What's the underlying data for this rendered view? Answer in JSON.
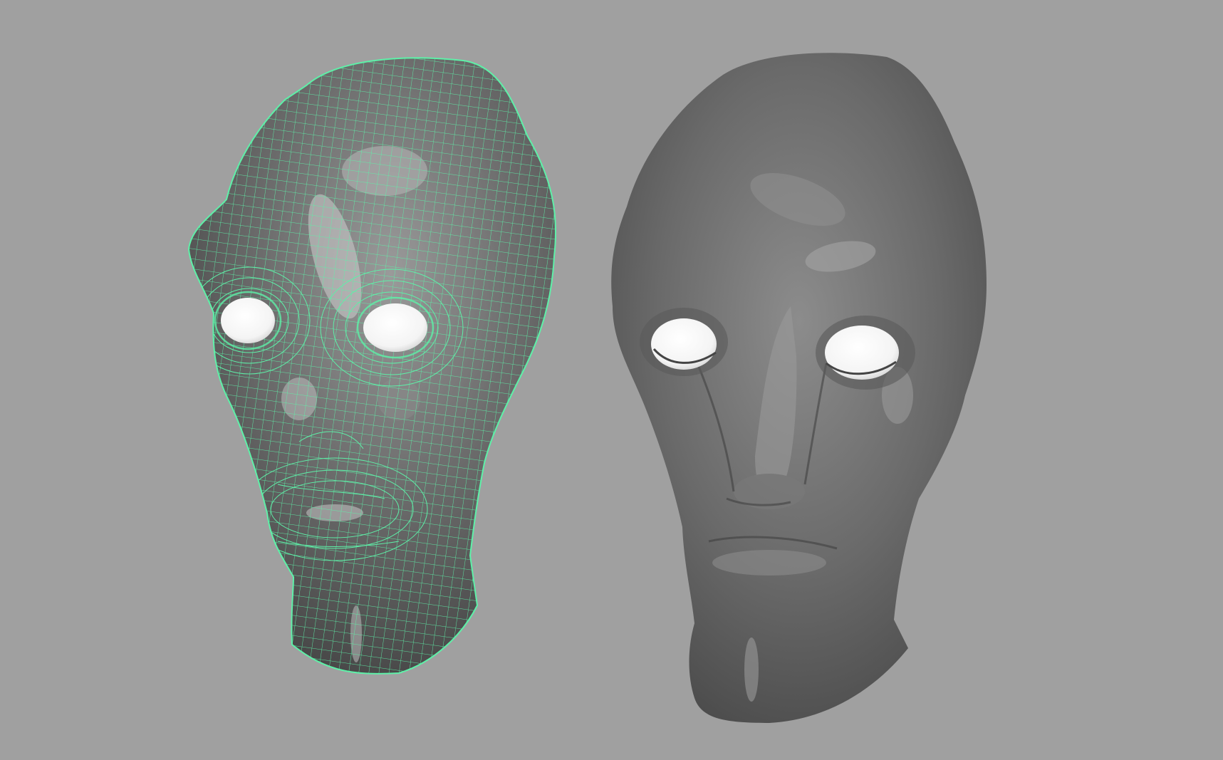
{
  "viewport": {
    "background_color": "#a0a0a0",
    "wireframe_color": "#5ef0a8",
    "surface_color": "#6f6f6f",
    "eye_color": "#ffffff"
  },
  "models": [
    {
      "name": "wireframe-head",
      "display_mode": "wireframe-on-shaded",
      "selected": true
    },
    {
      "name": "smooth-head",
      "display_mode": "smooth-shaded",
      "selected": false
    }
  ]
}
